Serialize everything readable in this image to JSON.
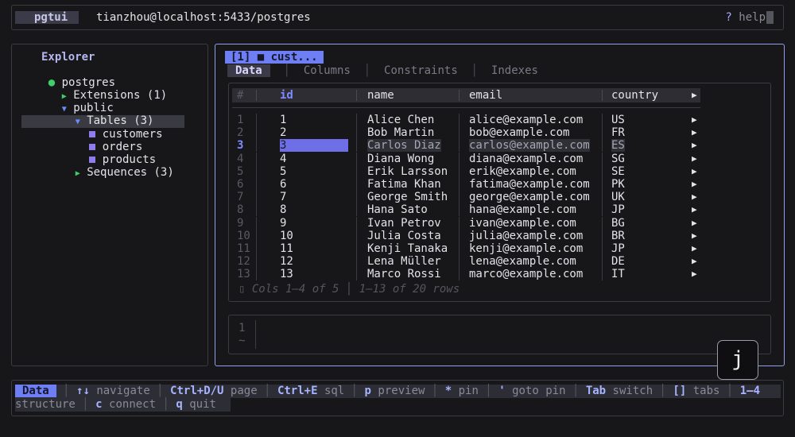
{
  "topbar": {
    "app_name": "pgtui",
    "connection": "tianzhou@localhost:5433/postgres",
    "help_key": "?",
    "help_label": "help"
  },
  "explorer": {
    "title": "Explorer",
    "db": "postgres",
    "extensions": "Extensions (1)",
    "schema": "public",
    "tables": "Tables (3)",
    "table_items": [
      "customers",
      "orders",
      "products"
    ],
    "sequences": "Sequences (3)"
  },
  "main": {
    "tab_title": "[1] ■ cust...",
    "tabs": [
      "Data",
      "Columns",
      "Constraints",
      "Indexes"
    ],
    "columns": [
      "#",
      "id",
      "name",
      "email",
      "country"
    ],
    "rows": [
      {
        "n": "1",
        "id": "1",
        "name": "Alice Chen",
        "email": "alice@example.com",
        "country": "US"
      },
      {
        "n": "2",
        "id": "2",
        "name": "Bob Martin",
        "email": "bob@example.com",
        "country": "FR"
      },
      {
        "n": "3",
        "id": "3",
        "name": "Carlos Diaz",
        "email": "carlos@example.com",
        "country": "ES"
      },
      {
        "n": "4",
        "id": "4",
        "name": "Diana Wong",
        "email": "diana@example.com",
        "country": "SG"
      },
      {
        "n": "5",
        "id": "5",
        "name": "Erik Larsson",
        "email": "erik@example.com",
        "country": "SE"
      },
      {
        "n": "6",
        "id": "6",
        "name": "Fatima Khan",
        "email": "fatima@example.com",
        "country": "PK"
      },
      {
        "n": "7",
        "id": "7",
        "name": "George Smith",
        "email": "george@example.com",
        "country": "UK"
      },
      {
        "n": "8",
        "id": "8",
        "name": "Hana Sato",
        "email": "hana@example.com",
        "country": "JP"
      },
      {
        "n": "9",
        "id": "9",
        "name": "Ivan Petrov",
        "email": "ivan@example.com",
        "country": "BG"
      },
      {
        "n": "10",
        "id": "10",
        "name": "Julia Costa",
        "email": "julia@example.com",
        "country": "BR"
      },
      {
        "n": "11",
        "id": "11",
        "name": "Kenji Tanaka",
        "email": "kenji@example.com",
        "country": "JP"
      },
      {
        "n": "12",
        "id": "12",
        "name": "Lena Müller",
        "email": "lena@example.com",
        "country": "DE"
      },
      {
        "n": "13",
        "id": "13",
        "name": "Marco Rossi",
        "email": "marco@example.com",
        "country": "IT"
      }
    ],
    "active_row": 3,
    "status": "▯ Cols 1–4 of 5 │ 1–13 of 20 rows",
    "editor_lines": [
      "1",
      "~"
    ]
  },
  "key_overlay": "j",
  "footer": {
    "mode": "Data",
    "line1": [
      {
        "k": "↑↓",
        "d": "navigate"
      },
      {
        "k": "Ctrl+D/U",
        "d": "page"
      },
      {
        "k": "Ctrl+E",
        "d": "sql"
      },
      {
        "k": "p",
        "d": "preview"
      },
      {
        "k": "*",
        "d": "pin"
      },
      {
        "k": "'",
        "d": "goto pin"
      },
      {
        "k": "Tab",
        "d": "switch"
      },
      {
        "k": "[]",
        "d": "tabs"
      },
      {
        "k": "1–4",
        "d": ""
      }
    ],
    "line2": [
      {
        "k": "",
        "d": "structure"
      },
      {
        "k": "c",
        "d": "connect"
      },
      {
        "k": "q",
        "d": "quit"
      }
    ]
  },
  "colors": {
    "accent": "#6e7ef5",
    "green": "#3ecf6a",
    "table_icon": "#8e7cf0",
    "background": "#17171a"
  }
}
